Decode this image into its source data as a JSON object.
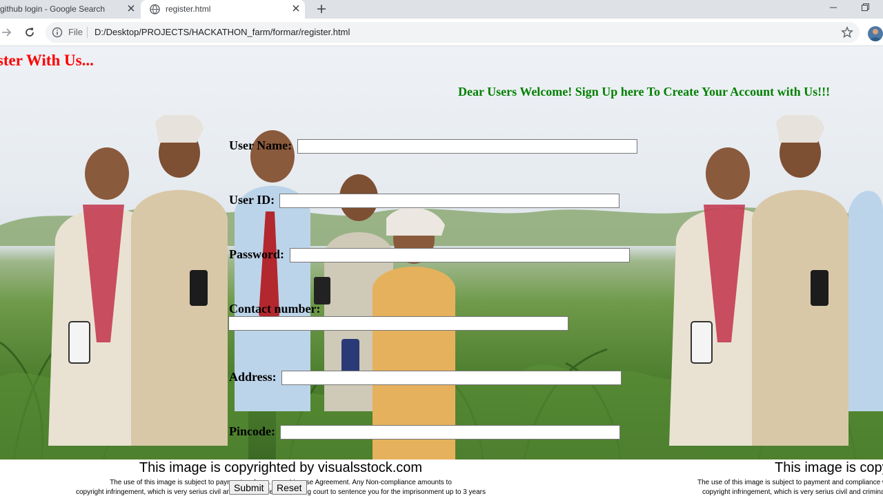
{
  "browser": {
    "tabs": [
      {
        "title": "github login - Google Search"
      },
      {
        "title": "register.html"
      }
    ],
    "address_bar": {
      "security_label": "File",
      "url": "D:/Desktop/PROJECTS/HACKATHON_farm/formar/register.html"
    }
  },
  "page": {
    "heading": "gister With Us...",
    "welcome": "Dear Users Welcome! Sign Up here To Create Your Account with Us!!!",
    "form": {
      "fields": [
        {
          "label": "User Name:",
          "value": ""
        },
        {
          "label": "User ID:",
          "value": ""
        },
        {
          "label": "Password:",
          "value": ""
        },
        {
          "label": "Contact number:",
          "value": ""
        },
        {
          "label": "Address:",
          "value": ""
        },
        {
          "label": "Pincode:",
          "value": ""
        }
      ],
      "submit_label": "Submit",
      "reset_label": "Reset"
    },
    "watermark": {
      "title": "This image is copyrighted by visualsstock.com",
      "title_right": "This image is copyri",
      "text_line1": "The use of this image is subject to payment and co... .com License Agreement. Any Non-compliance amounts to",
      "text_line2": "copyright infringement, which is very serius civil and criminal offence allowing court to sentence you for the imprisonment up to 3 years",
      "text_right1": "The use of this image is subject to payment and compliance w",
      "text_right2": "copyright infringement, which is very serius civil and criminal"
    }
  },
  "colors": {
    "heading": "#ff0000",
    "welcome": "#008000"
  }
}
